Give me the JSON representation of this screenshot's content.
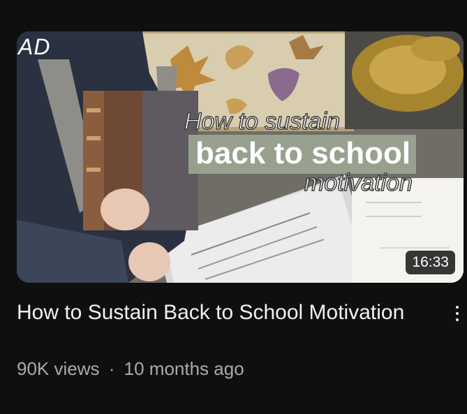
{
  "video": {
    "ad_label": "AD",
    "thumbnail_text": {
      "line1": "How to sustain",
      "line2": "back to school",
      "line3": "motivation"
    },
    "duration": "16:33",
    "title": "How to Sustain Back to School Motivation",
    "views": "90K views",
    "separator": "·",
    "age": "10 months ago",
    "menu_icon": "more-vert-icon"
  },
  "colors": {
    "background": "#0f0f0f",
    "title": "#f1f1f1",
    "meta": "#aaaaaa"
  }
}
